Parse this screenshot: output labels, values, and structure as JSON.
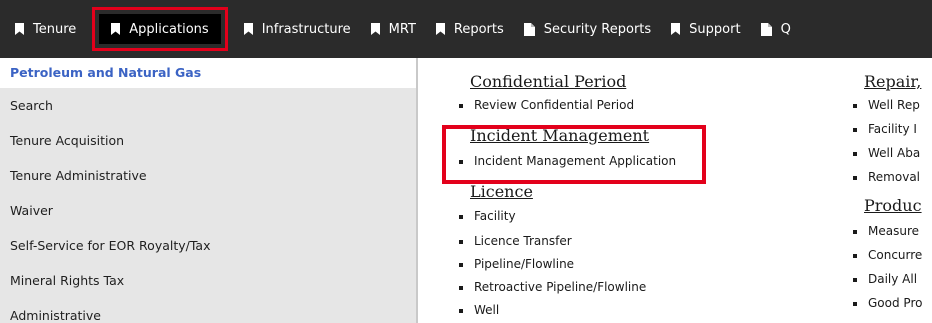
{
  "nav": {
    "items": [
      {
        "label": "Tenure",
        "icon": "bookmark-icon"
      },
      {
        "label": "Applications",
        "icon": "bookmark-icon"
      },
      {
        "label": "Infrastructure",
        "icon": "bookmark-icon"
      },
      {
        "label": "MRT",
        "icon": "bookmark-icon"
      },
      {
        "label": "Reports",
        "icon": "bookmark-icon"
      },
      {
        "label": "Security Reports",
        "icon": "document-icon"
      },
      {
        "label": "Support",
        "icon": "bookmark-icon"
      },
      {
        "label": "Q",
        "icon": "document-icon"
      }
    ],
    "active_item": "Applications"
  },
  "sidebar": {
    "header": "Petroleum and Natural Gas",
    "items": [
      {
        "label": "Search"
      },
      {
        "label": "Tenure Acquisition"
      },
      {
        "label": "Tenure Administrative"
      },
      {
        "label": "Waiver"
      },
      {
        "label": "Self-Service for EOR Royalty/Tax"
      },
      {
        "label": "Mineral Rights Tax"
      },
      {
        "label": "Administrative"
      }
    ]
  },
  "main": {
    "col1": {
      "sections": [
        {
          "title": "Confidential Period",
          "links": [
            "Review Confidential Period"
          ]
        },
        {
          "title": "Incident Management",
          "links": [
            "Incident Management Application"
          ]
        },
        {
          "title": "Licence",
          "links": [
            "Facility",
            "Licence Transfer",
            "Pipeline/Flowline",
            "Retroactive Pipeline/Flowline",
            "Well"
          ]
        }
      ]
    },
    "col2": {
      "sections": [
        {
          "title": "Repair,",
          "links": [
            "Well Rep",
            "Facility I",
            "Well Aba",
            "Removal"
          ]
        },
        {
          "title": "Produc",
          "links": [
            "Measure",
            "Concurre",
            "Daily All",
            "Good Pro"
          ]
        }
      ]
    }
  },
  "colors": {
    "nav_bg": "#2b2b2b",
    "highlight": "#e3001b",
    "sidebar_bg": "#e6e6e6",
    "sidebar_header": "#3b63c4"
  }
}
